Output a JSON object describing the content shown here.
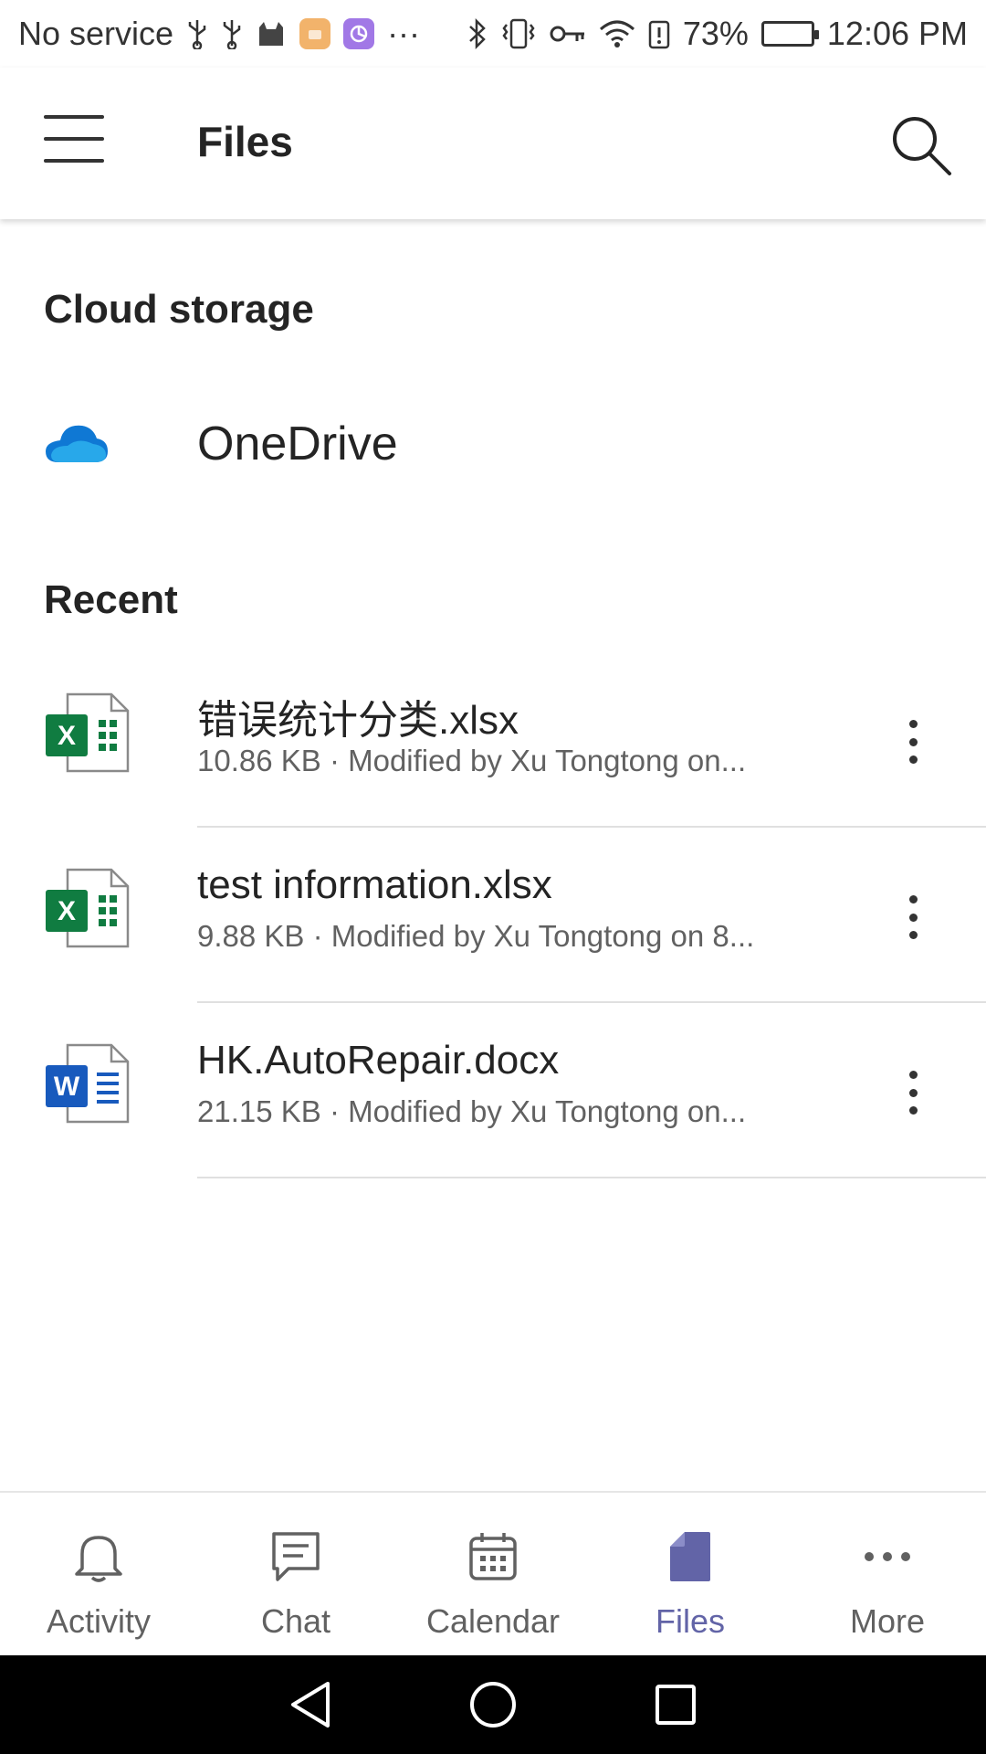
{
  "status_bar": {
    "carrier": "No service",
    "battery_percent": "73%",
    "time": "12:06 PM",
    "icons": [
      "usb-icon",
      "usb-icon",
      "cat-icon",
      "app-badge",
      "app-badge",
      "more-icon",
      "bluetooth-icon",
      "vibrate-icon",
      "key-icon",
      "wifi-icon",
      "alert-icon",
      "battery-icon"
    ],
    "overflow": "···"
  },
  "header": {
    "title": "Files"
  },
  "cloud_storage": {
    "heading": "Cloud storage",
    "items": [
      {
        "label": "OneDrive",
        "icon": "onedrive-icon"
      }
    ]
  },
  "recent": {
    "heading": "Recent",
    "files": [
      {
        "name": "错误统计分类.xlsx",
        "meta": "10.86 KB · Modified by Xu Tongtong on...",
        "type": "excel"
      },
      {
        "name": "test information.xlsx",
        "meta": "9.88 KB · Modified by Xu Tongtong on 8...",
        "type": "excel"
      },
      {
        "name": "HK.AutoRepair.docx",
        "meta": "21.15 KB · Modified by Xu Tongtong on...",
        "type": "word"
      }
    ]
  },
  "bottom_nav": {
    "items": [
      {
        "label": "Activity",
        "icon": "bell-icon"
      },
      {
        "label": "Chat",
        "icon": "chat-icon"
      },
      {
        "label": "Calendar",
        "icon": "calendar-icon"
      },
      {
        "label": "Files",
        "icon": "file-icon",
        "active": true
      },
      {
        "label": "More",
        "icon": "more-icon"
      }
    ]
  },
  "colors": {
    "accent": "#6264a7",
    "excel": "#107c41",
    "word": "#185abd",
    "onedrive": "#0f78d4"
  }
}
